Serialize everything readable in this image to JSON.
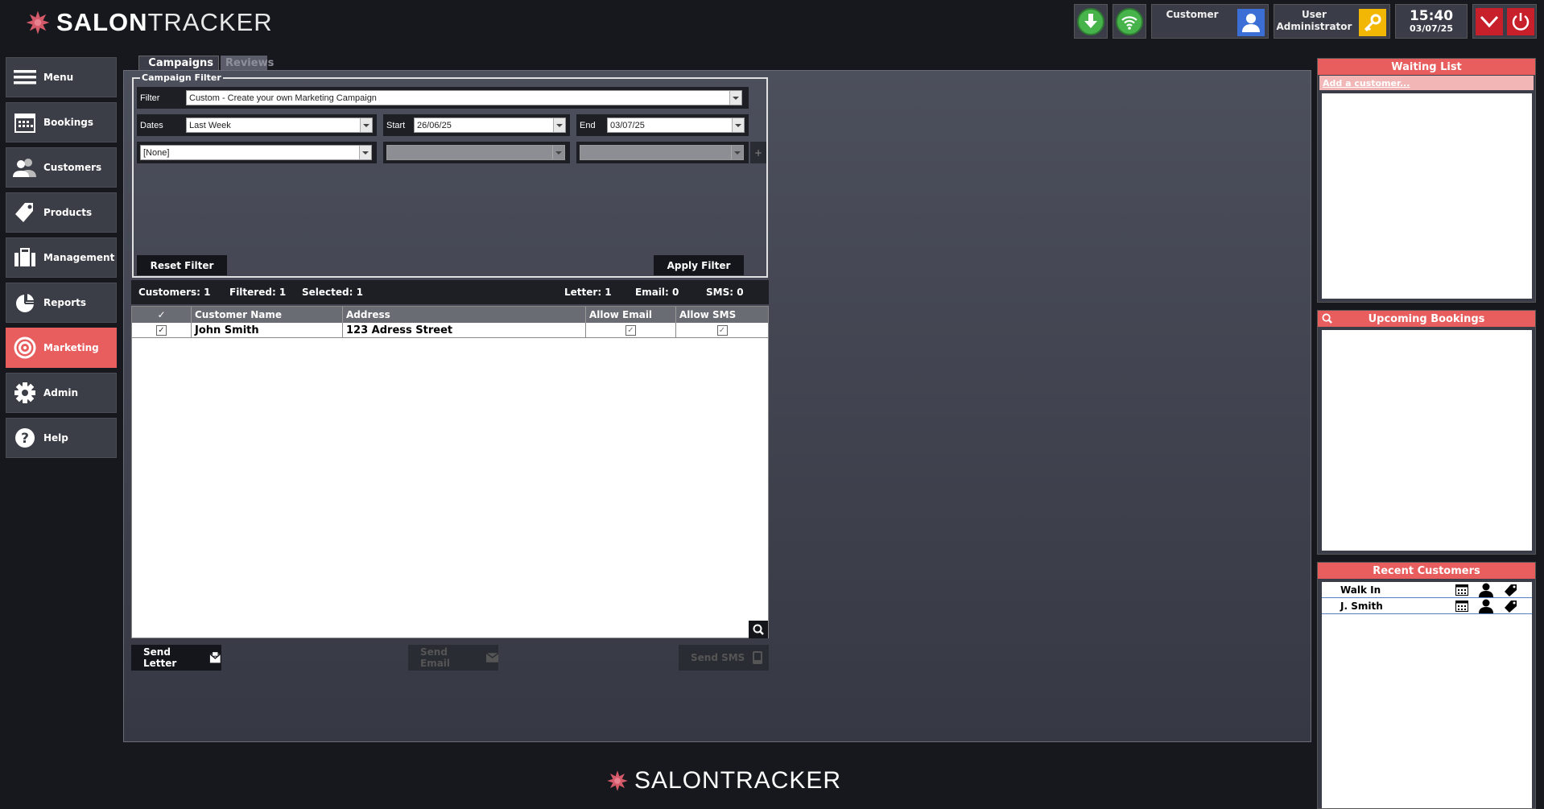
{
  "app": {
    "brand_bold": "SALON",
    "brand_light": "TRACKER"
  },
  "topbar": {
    "customer_label": "Customer",
    "user_label_line1": "User",
    "user_label_line2": "Administrator",
    "time": "15:40",
    "date": "03/07/25",
    "download_icon": "download-arrow-icon",
    "wifi_icon": "wifi-icon"
  },
  "sidebar": {
    "items": [
      {
        "label": "Menu",
        "icon": "hamburger-icon"
      },
      {
        "label": "Bookings",
        "icon": "calendar-icon"
      },
      {
        "label": "Customers",
        "icon": "people-icon"
      },
      {
        "label": "Products",
        "icon": "tag-icon"
      },
      {
        "label": "Management",
        "icon": "briefcase-icon"
      },
      {
        "label": "Reports",
        "icon": "pie-chart-icon"
      },
      {
        "label": "Marketing",
        "icon": "target-icon",
        "active": true
      },
      {
        "label": "Admin",
        "icon": "gear-icon"
      },
      {
        "label": "Help",
        "icon": "help-icon"
      }
    ]
  },
  "tabs": [
    {
      "label": "Campaigns",
      "active": true
    },
    {
      "label": "Reviews",
      "active": false
    }
  ],
  "filter": {
    "legend": "Campaign Filter",
    "filter_label": "Filter",
    "filter_value": "Custom - Create your own Marketing Campaign",
    "dates_label": "Dates",
    "dates_value": "Last Week",
    "start_label": "Start",
    "start_value": "26/06/25",
    "end_label": "End",
    "end_value": "03/07/25",
    "criteria_value": "[None]",
    "add_symbol": "+",
    "reset_label": "Reset Filter",
    "apply_label": "Apply Filter"
  },
  "stats": {
    "customers": "Customers:  1",
    "filtered": "Filtered:  1",
    "selected": "Selected:  1",
    "letter": "Letter:  1",
    "email": "Email:  0",
    "sms": "SMS:  0"
  },
  "grid": {
    "columns": [
      "✓",
      "Customer Name",
      "Address",
      "Allow Email",
      "Allow SMS"
    ],
    "rows": [
      {
        "checked": "✓",
        "name": "John Smith",
        "address": "123 Adress Street",
        "allow_email": "✓",
        "allow_sms": "✓"
      }
    ]
  },
  "actions": {
    "send_letter": "Send Letter",
    "send_email": "Send Email",
    "send_sms": "Send SMS"
  },
  "right": {
    "waiting_title": "Waiting List",
    "add_customer": "Add a customer...",
    "upcoming_title": "Upcoming Bookings",
    "recent_title": "Recent Customers",
    "recent": [
      "Walk In",
      "J. Smith"
    ]
  },
  "colors": {
    "accent": "#e85d5d",
    "panel": "#3a3d47",
    "background": "#16181d"
  }
}
